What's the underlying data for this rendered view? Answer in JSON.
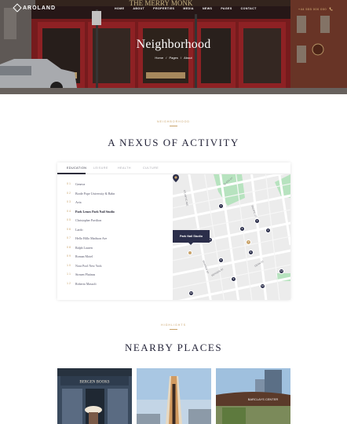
{
  "header": {
    "logo_text": "AROLAND",
    "nav": [
      "HOME",
      "ABOUT",
      "PROPERTIES",
      "MEDIA",
      "NEWS",
      "PAGES",
      "CONTACT"
    ],
    "contact_label": "+44 555 000 000",
    "phone_icon": "phone-icon"
  },
  "hero": {
    "title": "Neighborhood",
    "breadcrumb": [
      "Home",
      "/",
      "Pages",
      "/",
      "About"
    ],
    "storefront_sign": "THE MERRY MONK"
  },
  "neighborhood": {
    "eyebrow": "NEIGHBORHOOD",
    "title": "A NEXUS OF ACTIVITY",
    "tabs": [
      "EDUCATION",
      "LEISURE",
      "HEALTH",
      "CULTURE"
    ],
    "active_tab": 0,
    "places": [
      {
        "num": "0 1",
        "name": "Geneva"
      },
      {
        "num": "0 2",
        "name": "Borde Pope University & Bahn"
      },
      {
        "num": "0 3",
        "name": "Avia"
      },
      {
        "num": "0 4",
        "name": "Park Lenox Park Nail Studio"
      },
      {
        "num": "0 5",
        "name": "Christopher Pavilion"
      },
      {
        "num": "0 6",
        "name": "Lardo"
      },
      {
        "num": "0 7",
        "name": "Hello Hillo Madison Ave"
      },
      {
        "num": "0 8",
        "name": "Ralph Lauren"
      },
      {
        "num": "0 9",
        "name": "Roman Motel"
      },
      {
        "num": "1 0",
        "name": "Nora Pool New York"
      },
      {
        "num": "1 1",
        "name": "Sirmen Platinas"
      },
      {
        "num": "1 2",
        "name": "Roberto Massoli"
      }
    ],
    "active_place": 3,
    "map": {
      "popup_label": "Park Nail Studio",
      "pins": [
        "1",
        "2",
        "3",
        "4",
        "5",
        "6",
        "7",
        "8",
        "9",
        "10",
        "11",
        "12"
      ],
      "street_labels": [
        "ATLANTIC AVE",
        "W 4TH ST",
        "PACIFIC ST",
        "WARREN ST",
        "BERGEN ST",
        "DEAN ST"
      ],
      "colors": {
        "road": "#ffffff",
        "land": "#ececec",
        "park": "#b7e3bf",
        "pin": "#2b2e4a",
        "accent": "#c9a36a"
      }
    }
  },
  "nearby": {
    "eyebrow": "HIGHLIGHTS",
    "title": "NEARBY PLACES",
    "cards": [
      {
        "sign": "BERGEN BOOKS"
      },
      {
        "sign": ""
      },
      {
        "sign": "BARCLAYS CENTER"
      }
    ]
  }
}
